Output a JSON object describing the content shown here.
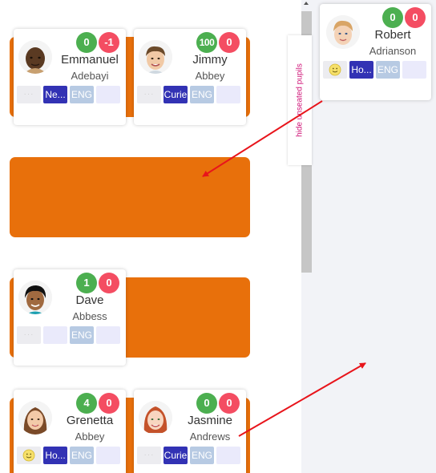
{
  "hide_tab_label": "hide unseated pupils",
  "tag_placeholder": "···",
  "colors": {
    "desk": "#e8700b",
    "house": "#3232b4",
    "lang": "#b7cae3",
    "positive": "#4caf50",
    "negative": "#f44d62",
    "arrow": "#e8141b"
  },
  "seated_pupils": [
    {
      "first": "Emmanuel",
      "last": "Adebayi",
      "positive": "0",
      "negative": "-1",
      "house": "Ne...",
      "lang": "ENG",
      "mood": "none",
      "avatar": "boy-dark-skin"
    },
    {
      "first": "Jimmy",
      "last": "Abbey",
      "positive": "100",
      "negative": "0",
      "house": "Curie",
      "lang": "ENG",
      "mood": "none",
      "avatar": "boy-brown-hair"
    },
    {
      "first": "Dave",
      "last": "Abbess",
      "positive": "1",
      "negative": "0",
      "house": "",
      "lang": "ENG",
      "mood": "none",
      "avatar": "boy-black-hair"
    },
    {
      "first": "Grenetta",
      "last": "Abbey",
      "positive": "4",
      "negative": "0",
      "house": "Ho...",
      "lang": "ENG",
      "mood": "smiley-icon",
      "avatar": "girl-brown-hair"
    },
    {
      "first": "Jasmine",
      "last": "Andrews",
      "positive": "0",
      "negative": "0",
      "house": "Curie",
      "lang": "ENG",
      "mood": "none",
      "avatar": "girl-red-hair"
    }
  ],
  "unseated_pupils": [
    {
      "first": "Robert",
      "last": "Adrianson",
      "positive": "0",
      "negative": "0",
      "house": "Ho...",
      "lang": "ENG",
      "mood": "smiley-icon",
      "avatar": "boy-light-hair"
    }
  ]
}
